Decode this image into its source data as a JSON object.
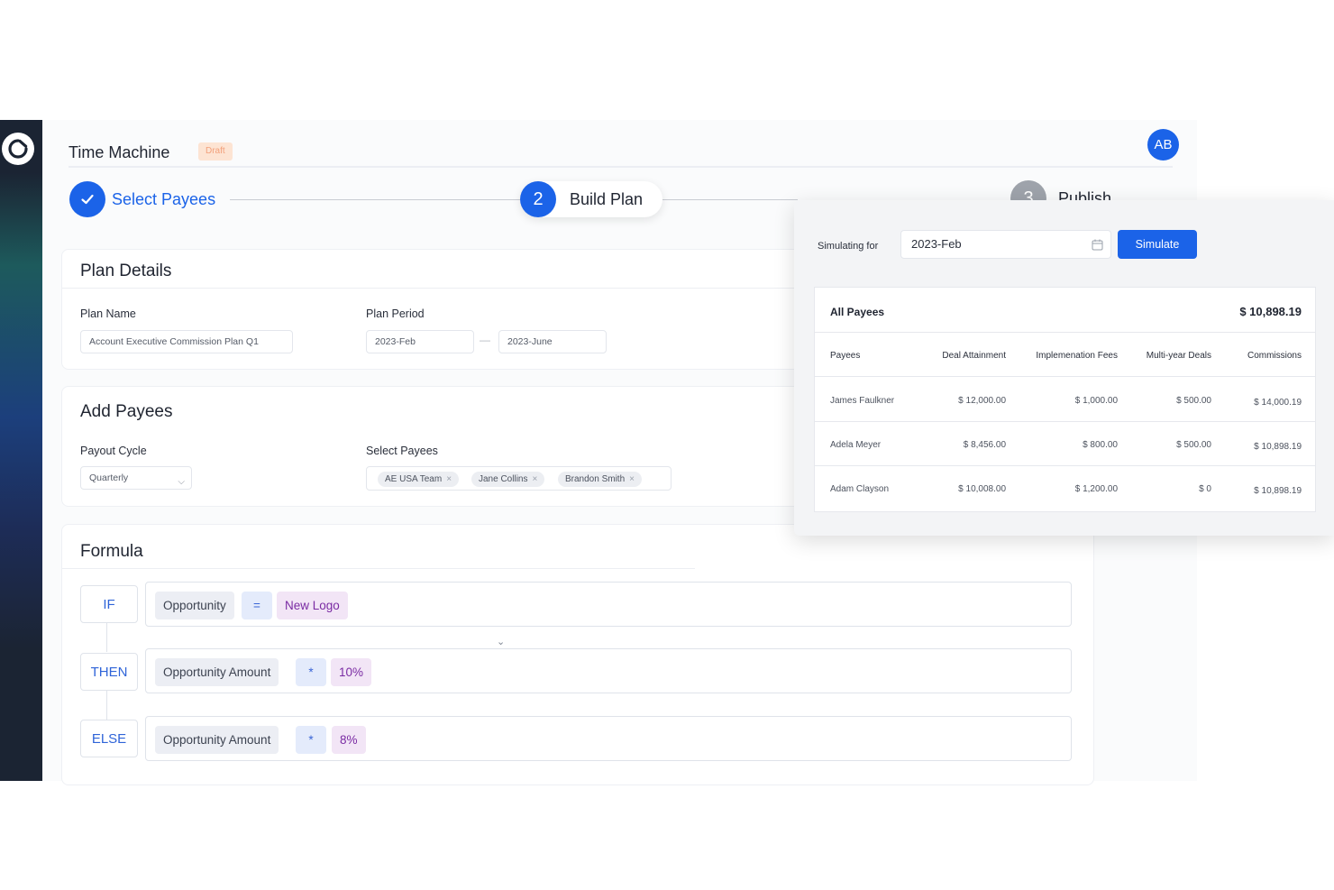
{
  "app": {
    "title": "Time Machine",
    "status_badge": "Draft",
    "avatar_initials": "AB"
  },
  "steps": [
    {
      "label": "Select Payees",
      "state": "done"
    },
    {
      "label": "Build Plan",
      "number": "2",
      "state": "active"
    },
    {
      "label": "Publish",
      "number": "3",
      "state": "pending"
    }
  ],
  "plan_details": {
    "title": "Plan Details",
    "plan_name_label": "Plan Name",
    "plan_name_value": "Account Executive Commission Plan Q1",
    "plan_period_label": "Plan Period",
    "period_start": "2023-Feb",
    "period_separator": "—",
    "period_end": "2023-June"
  },
  "add_payees": {
    "title": "Add Payees",
    "payout_cycle_label": "Payout Cycle",
    "payout_cycle_value": "Quarterly",
    "select_payees_label": "Select Payees",
    "tags": [
      "AE USA Team",
      "Jane Collins",
      "Brandon Smith"
    ],
    "remove_glyph": "×"
  },
  "formula": {
    "title": "Formula",
    "if_key": "IF",
    "then_key": "THEN",
    "else_key": "ELSE",
    "if_field": "Opportunity",
    "if_op": "=",
    "if_value": "New Logo",
    "then_field": "Opportunity Amount",
    "then_op": "*",
    "then_value": "10%",
    "else_field": "Opportunity Amount",
    "else_op": "*",
    "else_value": "8%"
  },
  "simulation": {
    "label": "Simulating for",
    "date": "2023-Feb",
    "button": "Simulate",
    "table_title": "All Payees",
    "total": "$ 10,898.19",
    "columns": [
      "Payees",
      "Deal Attainment",
      "Implemenation Fees",
      "Multi-year Deals",
      "Commissions"
    ],
    "rows": [
      [
        "James Faulkner",
        "$ 12,000.00",
        "$ 1,000.00",
        "$ 500.00",
        "$ 14,000.19"
      ],
      [
        "Adela Meyer",
        "$ 8,456.00",
        "$ 800.00",
        "$ 500.00",
        "$ 10,898.19"
      ],
      [
        "Adam Clayson",
        "$ 10,008.00",
        "$ 1,200.00",
        "$ 0",
        "$ 10,898.19"
      ]
    ]
  },
  "colors": {
    "primary": "#1b63e8",
    "badge_bg": "#fde4d3",
    "badge_text": "#f2a07b",
    "value_chip": "#f2e5f6"
  }
}
